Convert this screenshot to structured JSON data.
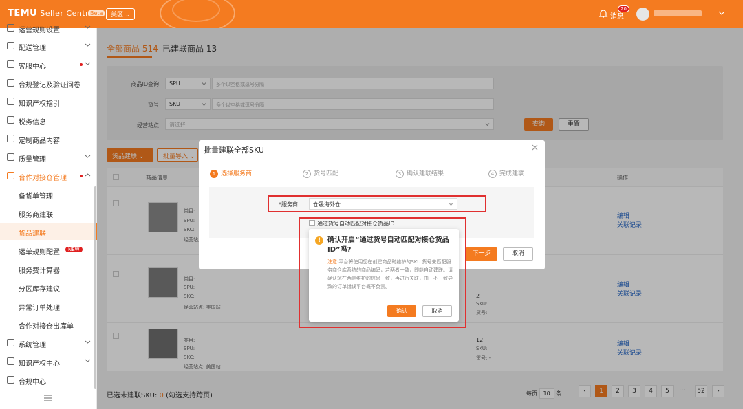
{
  "header": {
    "logo": "TEMU",
    "logo_sub": "Seller Central",
    "beta": "Beta",
    "region": "美区 ⌄",
    "messages_label": "消息",
    "messages_count": "20",
    "brand_color": "#f47b20"
  },
  "sidebar": {
    "items": [
      {
        "label": "运营规则设置",
        "type": "group"
      },
      {
        "label": "配送管理",
        "type": "group"
      },
      {
        "label": "客服中心",
        "type": "group"
      },
      {
        "label": "合规登记及验证问卷",
        "type": "item"
      },
      {
        "label": "知识产权指引",
        "type": "item"
      },
      {
        "label": "税务信息",
        "type": "item"
      },
      {
        "label": "定制商品内容",
        "type": "item"
      },
      {
        "label": "质量管理",
        "type": "group"
      },
      {
        "label": "合作对接仓管理",
        "type": "group-open"
      },
      {
        "label": "备货单管理",
        "type": "sub"
      },
      {
        "label": "服务商建联",
        "type": "sub"
      },
      {
        "label": "货品建联",
        "type": "sub-active"
      },
      {
        "label": "运单规则配置",
        "type": "sub",
        "badge": "NEW"
      },
      {
        "label": "服务费计算器",
        "type": "sub"
      },
      {
        "label": "分区库存建议",
        "type": "sub"
      },
      {
        "label": "异常订单处理",
        "type": "sub"
      },
      {
        "label": "合作对接仓出库单",
        "type": "sub"
      },
      {
        "label": "系统管理",
        "type": "group"
      },
      {
        "label": "知识产权中心",
        "type": "group"
      },
      {
        "label": "合规中心",
        "type": "item"
      }
    ]
  },
  "tabs": {
    "all": "全部商品 514",
    "linked": "已建联商品 13"
  },
  "filters": {
    "id_label": "商品ID查询",
    "id_type": "SPU",
    "id_placeholder": "多个以空格或逗号分隔",
    "code_label": "货号",
    "code_type": "SKU",
    "code_placeholder": "多个以空格或逗号分隔",
    "site_label": "经营站点",
    "site_placeholder": "请选择",
    "query_btn": "查询",
    "reset_btn": "重置"
  },
  "actions": {
    "link_btn": "货品建联 ⌄",
    "import_btn": "批量导入 ⌄"
  },
  "table": {
    "headers": {
      "product": "商品信息",
      "ops": "操作"
    },
    "rows": [
      {
        "spu": "SPU:",
        "skc": "SKC:",
        "site": "经营站点:",
        "cat": "类目:",
        "ops": [
          "编辑",
          "关联记录"
        ]
      },
      {
        "spu": "SPU:",
        "skc": "SKC:",
        "site": "经营站点: 美国站",
        "cat": "类目:",
        "qty1": "2",
        "sku_label": "SKU:",
        "code_label": "货号:",
        "ops": [
          "编辑",
          "关联记录"
        ]
      },
      {
        "spu": "SPU:",
        "skc": "SKC:",
        "site": "经营站点: 美国站",
        "cat": "类目:",
        "qty1": "12",
        "sku_label": "SKU:",
        "code_label": "货号:",
        "code_val": "-",
        "ops": [
          "编辑",
          "关联记录"
        ]
      }
    ]
  },
  "footer": {
    "selected_prefix": "已选未建联SKU:",
    "selected_count": "0",
    "selected_hint": "(勾选支持跨页)",
    "page_size_label": "每页",
    "page_size": "10",
    "page_size_unit": "条",
    "pages": [
      "1",
      "2",
      "3",
      "4",
      "5",
      "52"
    ],
    "ellipsis": "···",
    "current_page": "1"
  },
  "modal": {
    "title": "批量建联全部SKU",
    "steps": [
      {
        "n": "1",
        "label": "选择服务商",
        "state": "current"
      },
      {
        "n": "2",
        "label": "货号匹配",
        "state": "todo"
      },
      {
        "n": "3",
        "label": "确认建联结果",
        "state": "todo"
      },
      {
        "n": "4",
        "label": "完成建联",
        "state": "todo"
      }
    ],
    "service_label": "*服务商",
    "service_value": "仓晟海外仓",
    "auto_match_label": "通过货号自动匹配对接仓货品ID",
    "next_btn": "下一步",
    "cancel_btn": "取消"
  },
  "popconfirm": {
    "title": "确认开启“通过货号自动匹配对接仓货品ID”吗?",
    "note_prefix": "注意:",
    "body": "平台将使用您在创建商品时维护的SKU 货号来匹配服务商仓库系统的商品编码，若两者一致，即能自动建联。请确认您在两侧维护的信息一致，再进行关联，由于不一致导致的订单错误平台概不负责。",
    "ok_btn": "确认",
    "cancel_btn": "取消"
  }
}
